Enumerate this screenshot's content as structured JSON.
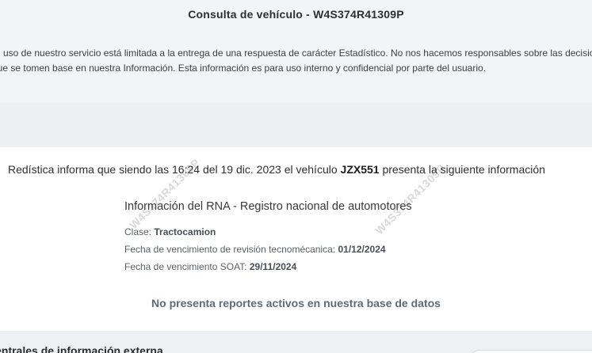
{
  "header": {
    "title": "Consulta de vehículo - W4S374R41309P",
    "disclaimer_line1": "El uso de nuestro servicio está limitada a la entrega de una respuesta de carácter Estadístico. No nos hacemos responsables sobre las decisiones",
    "disclaimer_line2": "que se tomen base en nuestra Información. Esta información es para uso interno y confidencial por parte del usuario."
  },
  "report": {
    "intro_prefix": "Redística informa que siendo las",
    "time": "16:24",
    "intro_del": "del",
    "date": "19 dic. 2023",
    "intro_vehicle": "el vehículo",
    "plate": "JZX551",
    "intro_suffix": "presenta la siguiente información",
    "watermark": "W4S374R41309P",
    "rna_title": "Información del RNA - Registro nacional de automotores",
    "fields": [
      {
        "label": "Clase:",
        "value": "Tractocamion"
      },
      {
        "label": "Fecha de vencimiento de revisión tecnomécanica:",
        "value": "01/12/2024"
      },
      {
        "label": "Fecha de vencimiento SOAT:",
        "value": "29/11/2024"
      }
    ],
    "no_reports": "No presenta reportes activos en nuestra base de datos"
  },
  "external": {
    "section_title": "Centrales de información externa"
  }
}
